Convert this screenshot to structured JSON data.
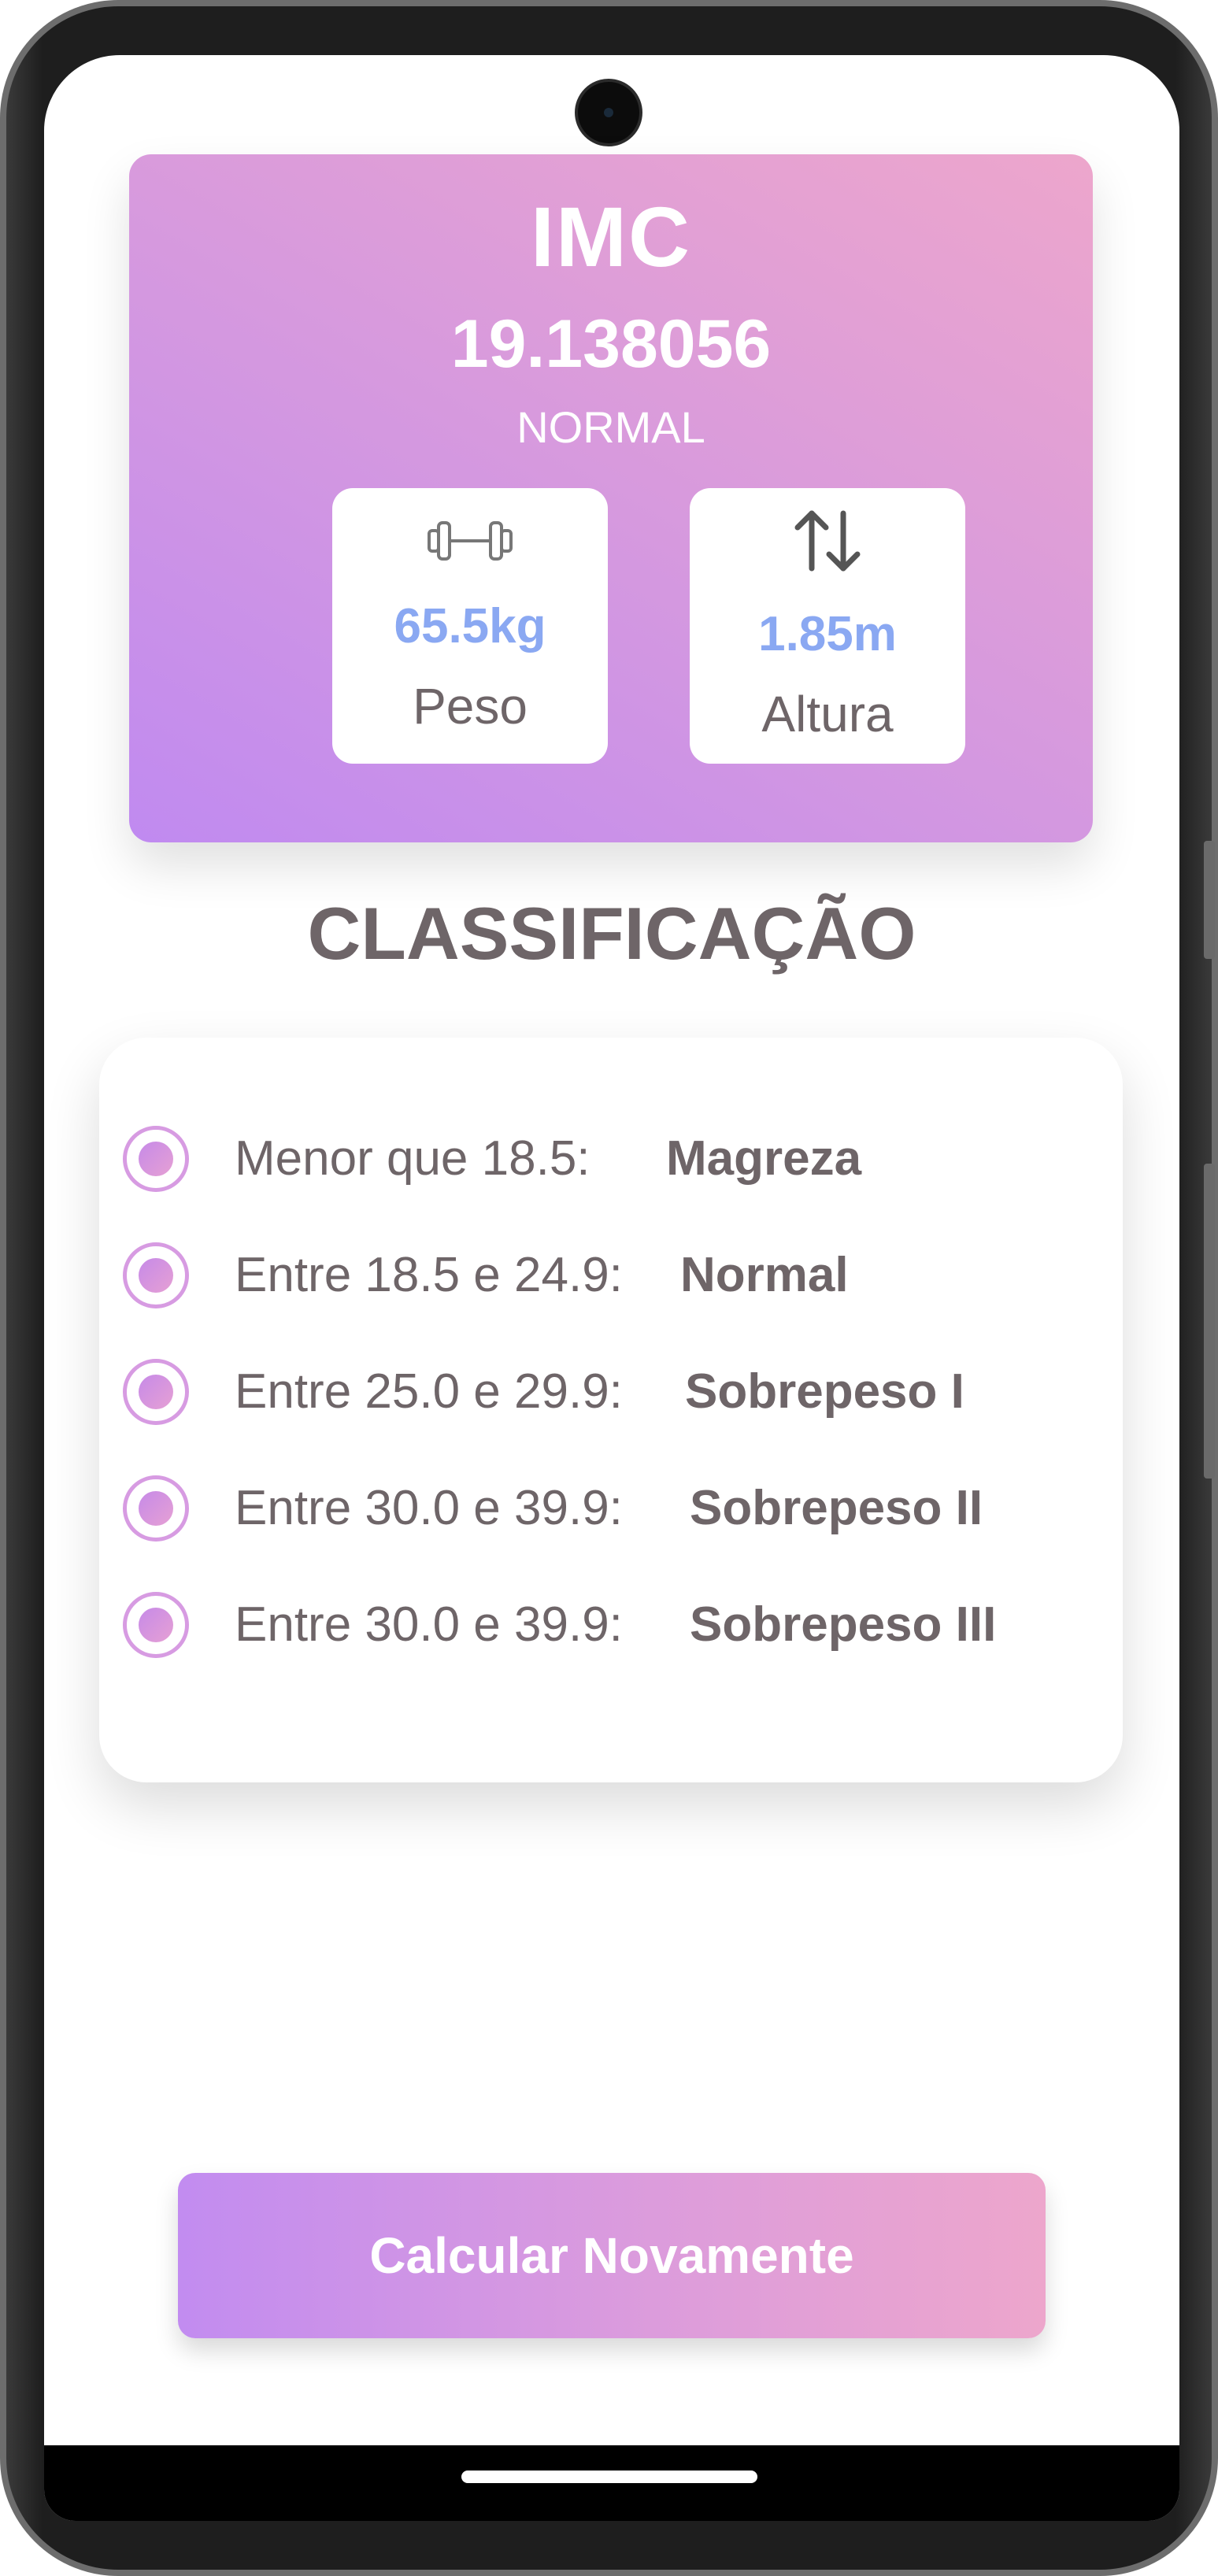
{
  "result": {
    "title": "IMC",
    "value": "19.138056",
    "status": "NORMAL",
    "weight": {
      "value": "65.5kg",
      "label": "Peso",
      "icon": "dumbbell-icon"
    },
    "height": {
      "value": "1.85m",
      "label": "Altura",
      "icon": "up-down-arrows-icon"
    }
  },
  "classification": {
    "title": "CLASSIFICAÇÃO",
    "items": [
      {
        "range": "Menor que 18.5:",
        "name": "Magreza"
      },
      {
        "range": "Entre 18.5 e 24.9:",
        "name": "Normal"
      },
      {
        "range": "Entre 25.0 e 29.9:",
        "name": "Sobrepeso I"
      },
      {
        "range": "Entre 30.0 e 39.9:",
        "name": "Sobrepeso II"
      },
      {
        "range": "Entre 30.0 e 39.9:",
        "name": "Sobrepeso III"
      }
    ]
  },
  "actions": {
    "recalculate_label": "Calcular Novamente"
  },
  "colors": {
    "gradient_start": "#c08af0",
    "gradient_end": "#eda6cc",
    "accent_value": "#8aa8f2",
    "text_dark": "#6e6568"
  }
}
